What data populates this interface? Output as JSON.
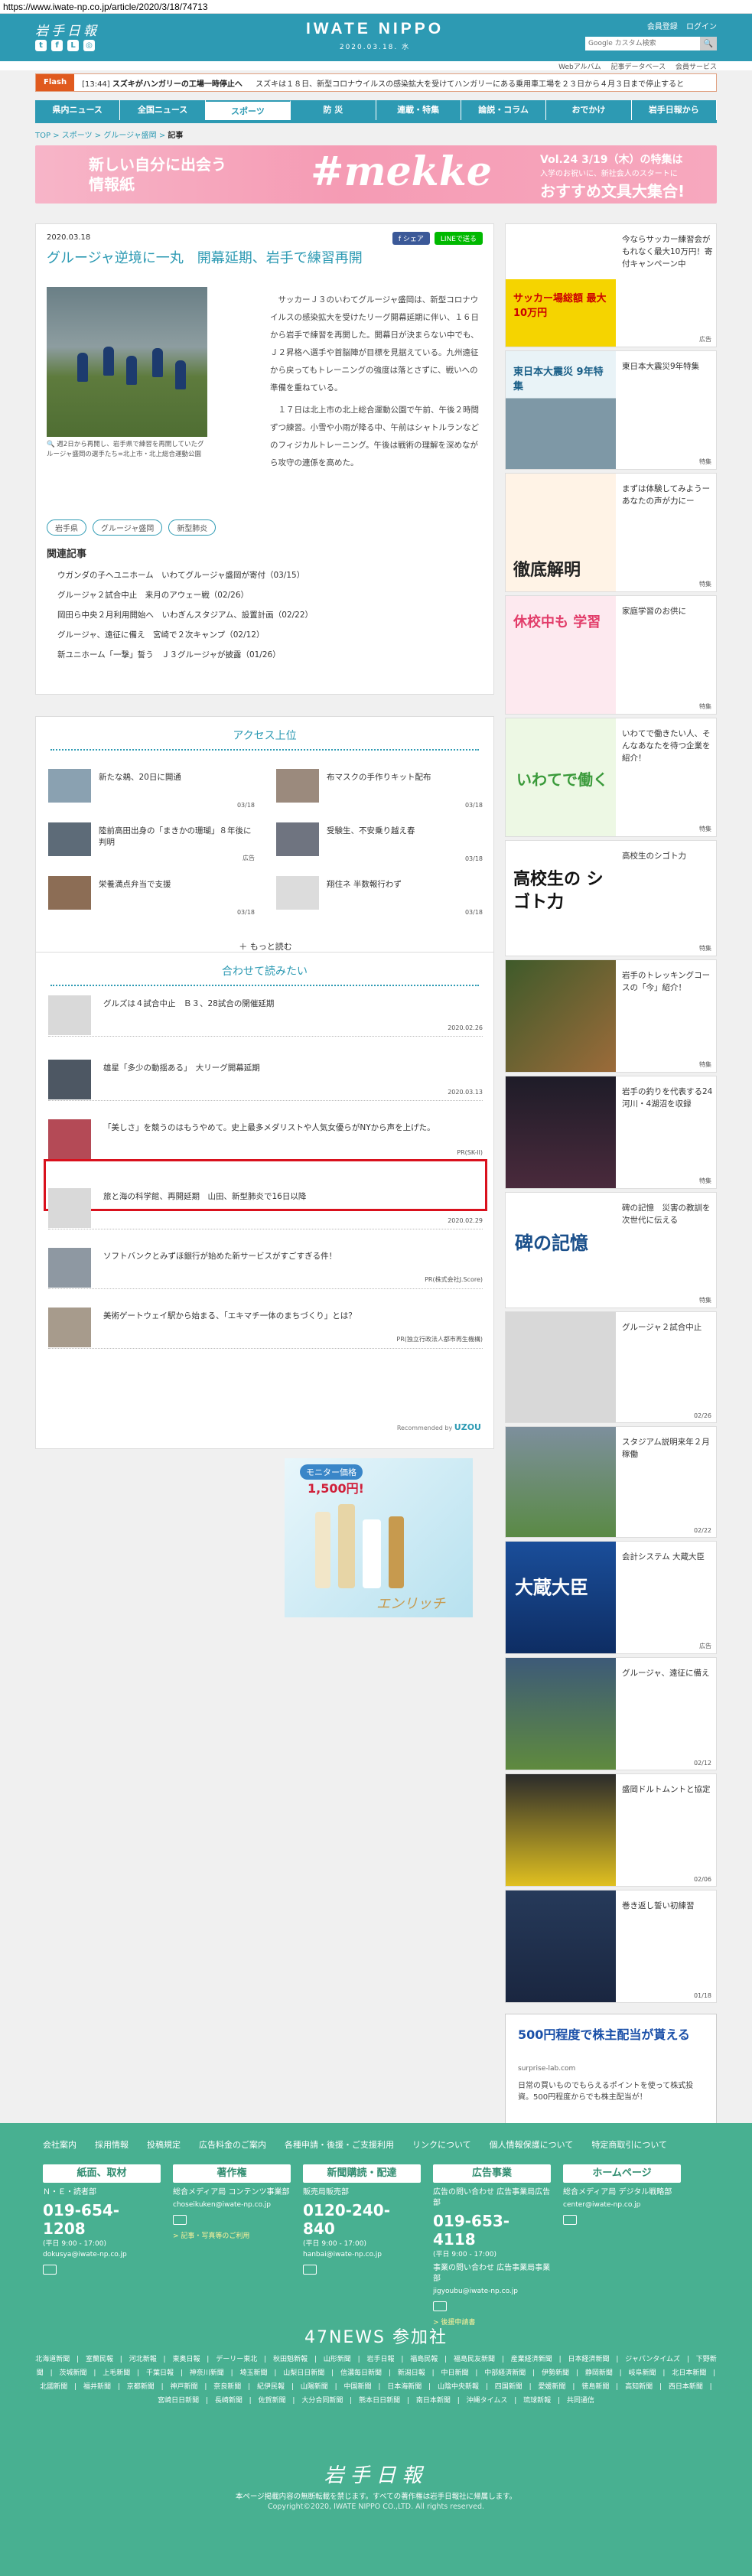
{
  "url": "https://www.iwate-np.co.jp/article/2020/3/18/74713",
  "header": {
    "logo_jp": "岩手日報",
    "logo_en": "IWATE NIPPO",
    "date": "2020.03.18. 水",
    "links": [
      "会員登録",
      "ログイン"
    ],
    "search_placeholder": "Google カスタム検索",
    "search_button": "🔍",
    "sub_links": [
      "Webアルバム",
      "記事データベース",
      "会員サービス"
    ]
  },
  "flash": {
    "tag": "Flash",
    "time": "[13:44]",
    "headline": "スズキがハンガリーの工場一時停止へ",
    "text": "スズキは１８日、新型コロナウイルスの感染拡大を受けてハンガリーにある乗用車工場を２３日から４月３日まで停止すると"
  },
  "nav": [
    "県内ニュース",
    "全国ニュース",
    "スポーツ",
    "防 災",
    "連載・特集",
    "論説・コラム",
    "おでかけ",
    "岩手日報から"
  ],
  "breadcrumb": {
    "items": [
      "TOP",
      "スポーツ",
      "グルージャ盛岡"
    ],
    "current": "記事"
  },
  "banner": {
    "line1": "新しい自分に出会う",
    "line2": "情報紙",
    "brand": "#mekke",
    "vol": "Vol.24 3/19（木）の特集は",
    "sub": "入学のお祝いに、新社会人のスタートに",
    "cta": "おすすめ文具大集合!"
  },
  "article": {
    "date": "2020.03.18",
    "share_fb": "f シェア",
    "share_line": "LINEで送る",
    "title": "グルージャ逆境に一丸　開幕延期、岩手で練習再開",
    "caption": "🔍 週2日から再開し、岩手県で練習を再開していたグルージャ盛岡の選手たち=北上市・北上総合運動公園",
    "para1": "サッカーＪ３のいわてグルージャ盛岡は、新型コロナウイルスの感染拡大を受けたリーグ開幕延期に伴い、１６日から岩手で練習を再開した。開幕日が決まらない中でも、Ｊ２昇格へ選手や首脳陣が目標を見据えている。九州遠征から戻ってもトレーニングの強度は落とさずに、戦いへの準備を重ねている。",
    "para2": "１７日は北上市の北上総合運動公園で午前、午後２時間ずつ練習。小雪や小雨が降る中、午前はシャトルランなどのフィジカルトレーニング。午後は戦術の理解を深めながら攻守の連係を高めた。",
    "tags": [
      "岩手県",
      "グルージャ盛岡",
      "新型肺炎"
    ],
    "related_heading": "関連記事",
    "related": [
      "ウガンダの子へユニホーム　いわてグルージャ盛岡が寄付（03/15）",
      "グルージャ２試合中止　来月のアウェー戦（02/26）",
      "岡田ら中央２月利用開始へ　いわぎんスタジアム、設置計画（02/22）",
      "グルージャ、遠征に備え　宮崎で２次キャンプ（02/12）",
      "新ユニホーム「一撃」誓う　Ｊ３グルージャが披露（01/26）"
    ]
  },
  "ranking": {
    "heading": "アクセス上位",
    "items": [
      {
        "title": "新たな鵜、20日に開通",
        "date": "03/18"
      },
      {
        "title": "布マスクの手作りキット配布",
        "date": "03/18"
      },
      {
        "title": "陸前高田出身の「まきかの珊瑚」８年後に判明",
        "date": "広告"
      },
      {
        "title": "受験生、不安乗り越え春",
        "date": "03/18"
      },
      {
        "title": "栄養満点弁当で支援",
        "date": "03/18"
      },
      {
        "title": "翔住ネ 半数報行わず",
        "date": "03/18"
      }
    ],
    "more": "＋ もっと読む"
  },
  "recommend": {
    "heading": "合わせて読みたい",
    "items": [
      {
        "title": "グルズは４試合中止　Ｂ３、28試合の開催延期",
        "date": "2020.02.26"
      },
      {
        "title": "雄星「多少の動揺ある」　大リーグ開幕延期",
        "date": "2020.03.13"
      },
      {
        "title": "「美しさ」を競うのはもうやめて。史上最多メダリストや人気女優らがNYから声を上げた。",
        "date": "PR(SK-II)"
      },
      {
        "title": "旅と海の科学館、再開延期　山田、新型肺炎で16日以降",
        "date": "2020.02.29"
      },
      {
        "title": "ソフトバンクとみずほ銀行が始めた新サービスがすごすぎる件！",
        "date": "PR(株式会社J.Score)"
      },
      {
        "title": "美術ゲートウェイ駅から始まる、「エキマチ一体のまちづくり」とは？",
        "date": "PR(独立行政法人都市再生機構)"
      }
    ],
    "powered": "Recommended by",
    "brand": "UZOU"
  },
  "ad_middle": {
    "line1": "モニター価格",
    "price": "1,500円!",
    "brand": "エンリッチ"
  },
  "sidebar": [
    {
      "title": "今ならサッカー練習会がもれなく最大10万円！寄付キャンペーン中",
      "meta": "広告",
      "label": "サッカー場総額 最大10万円"
    },
    {
      "title": "東日本大震災9年特集",
      "meta": "特集",
      "label": "東日本大震災 9年特集"
    },
    {
      "title": "まずは体験してみようーあなたの声が力にー",
      "meta": "特集",
      "label": "徹底解明"
    },
    {
      "title": "家庭学習のお供に",
      "meta": "特集",
      "label": "休校中も 学習"
    },
    {
      "title": "いわてで働きたい人、そんなあなたを待つ企業を紹介！",
      "meta": "特集",
      "label": "いわてで働く"
    },
    {
      "title": "高校生のシゴト力",
      "meta": "特集",
      "label": "高校生の シゴト力"
    },
    {
      "title": "岩手のトレッキングコースの「今」紹介！",
      "meta": "特集",
      "label": ""
    },
    {
      "title": "岩手の釣りを代表する24河川・4湖沼を収録",
      "meta": "特集",
      "label": ""
    },
    {
      "title": "碑の記憶　災害の教訓を次世代に伝える",
      "meta": "特集",
      "label": "碑の記憶"
    },
    {
      "title": "グルージャ２試合中止",
      "meta": "02/26",
      "label": ""
    },
    {
      "title": "スタジアム説明来年２月稼働",
      "meta": "02/22",
      "label": ""
    },
    {
      "title": "会計システム 大蔵大臣",
      "meta": "広告",
      "label": "大蔵大臣"
    },
    {
      "title": "グルージャ、遠征に備え",
      "meta": "02/12",
      "label": ""
    },
    {
      "title": "盛岡ドルトムントと協定",
      "meta": "02/06",
      "label": ""
    },
    {
      "title": "巻き返し誓い初練習",
      "meta": "01/18",
      "label": ""
    }
  ],
  "side_ad": {
    "title": "500円程度で株主配当が貰える",
    "site": "surprise-lab.com",
    "text": "日常の買いものでもらえるポイントを使って株式投資。500円程度からでも株主配当が！"
  },
  "footer": {
    "links": [
      "会社案内",
      "採用情報",
      "投稿規定",
      "広告料金のご案内",
      "各種申請・後援・ご支援利用",
      "リンクについて",
      "個人情報保護について",
      "特定商取引について"
    ],
    "boxes": [
      {
        "heading": "紙面、取材",
        "label": "Ｎ・Ｅ・読者部",
        "tel": "019-654-1208",
        "hours": "(平日 9:00 - 17:00)",
        "email": "dokusya@iwate-np.co.jp"
      },
      {
        "heading": "著作権",
        "label": "総合メディア局 コンテンツ事業部",
        "tel": "",
        "hours": "",
        "email": "choseikuken@iwate-np.co.jp",
        "note": "> 記事・写真等のご利用"
      },
      {
        "heading": "新聞購読・配達",
        "label": "販売局販売部",
        "tel": "0120-240-840",
        "hours": "(平日 9:00 - 17:00)",
        "email": "hanbai@iwate-np.co.jp"
      },
      {
        "heading": "広告事業",
        "label": "広告の問い合わせ 広告事業局広告部",
        "tel": "019-653-4118",
        "hours": "(平日 9:00 - 17:00)",
        "email": "",
        "label2": "事業の問い合わせ 広告事業局事業部",
        "email2": "jigyoubu@iwate-np.co.jp",
        "note": "> 後援申請書"
      },
      {
        "heading": "ホームページ",
        "label": "総合メディア局 デジタル戦略部",
        "tel": "",
        "hours": "",
        "email": "center@iwate-np.co.jp"
      }
    ],
    "n47": "47NEWS 参加社",
    "papers": "北海道新聞 | 室蘭民報 | 河北新報 | 東奥日報 | デーリー東北 | 秋田魁新報 | 山形新聞 | 岩手日報 | 福島民報 | 福島民友新聞 | 産業経済新聞 | 日本経済新聞 | ジャパンタイムズ | 下野新聞 | 茨城新聞 | 上毛新聞 | 千葉日報 | 神奈川新聞 | 埼玉新聞 | 山梨日日新聞 | 信濃毎日新聞 | 新潟日報 | 中日新聞 | 中部経済新聞 | 伊勢新聞 | 静岡新聞 | 岐阜新聞 | 北日本新聞 | 北國新聞 | 福井新聞 | 京都新聞 | 神戸新聞 | 奈良新聞 | 紀伊民報 | 山陽新聞 | 中国新聞 | 日本海新聞 | 山陰中央新報 | 四国新聞 | 愛媛新聞 | 徳島新聞 | 高知新聞 | 西日本新聞 | 宮崎日日新聞 | 長崎新聞 | 佐賀新聞 | 大分合同新聞 | 熊本日日新聞 | 南日本新聞 | 沖縄タイムス | 琉球新報 | 共同通信",
    "logo": "岩手日報",
    "note": "本ページ掲載内容の無断転載を禁じます。すべての著作権は岩手日報社に帰属します。",
    "copyright": "Copyright©2020, IWATE NIPPO CO.,LTD. All rights reserved."
  },
  "colors": {
    "brand": "#2d9ab3",
    "footer": "#48b091",
    "flash": "#e05a1e",
    "highlight": "#d9111d"
  }
}
